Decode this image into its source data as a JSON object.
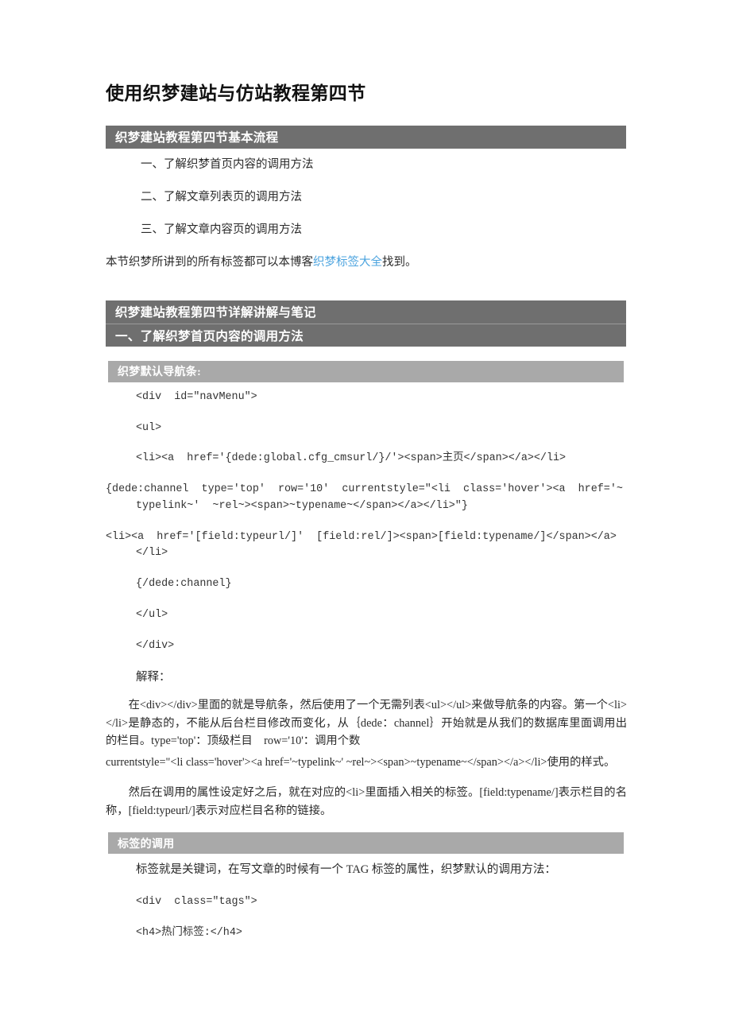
{
  "document": {
    "title": "使用织梦建站与仿站教程第四节"
  },
  "sections": {
    "overview": {
      "bar_label": "织梦建站教程第四节基本流程",
      "items": [
        "一、了解织梦首页内容的调用方法",
        "二、了解文章列表页的调用方法",
        "三、了解文章内容页的调用方法"
      ],
      "note_before_link": "本节织梦所讲到的所有标签都可以本博客",
      "note_link_text": "织梦标签大全",
      "note_after_link": "找到。"
    },
    "detail": {
      "bar_label": "织梦建站教程第四节详解讲解与笔记",
      "sub_bar_label": "一、了解织梦首页内容的调用方法"
    },
    "navbar": {
      "bar_label": "织梦默认导航条:",
      "code_lines": [
        "<div  id=\"navMenu\">",
        "<ul>",
        "<li><a  href='{dede:global.cfg_cmsurl/}/'><span>主页</span></a></li>",
        "{dede:channel  type='top'  row='10'  currentstyle=\"<li  class='hover'><a  href='~typelink~'  ~rel~><span>~typename~</span></a></li>\"}",
        "<li><a  href='[field:typeurl/]'  [field:rel/]><span>[field:typename/]</span></a></li>",
        "{/dede:channel}",
        "</ul>",
        "</div>"
      ],
      "explain_label": "解释：",
      "explain_p1": "在<div></div>里面的就是导航条，然后使用了一个无需列表<ul></ul>来做导航条的内容。第一个<li></li>是静态的，不能从后台栏目修改而变化，从｛dede：channel｝开始就是从我们的数据库里面调用出的栏目。type='top'：顶级栏目　row='10'：调用个数",
      "explain_p2": "currentstyle=\"<li class='hover'><a href='~typelink~' ~rel~><span>~typename~</span></a></li>使用的样式。",
      "explain_p3": "然后在调用的属性设定好之后，就在对应的<li>里面插入相关的标签。[field:typename/]表示栏目的名称，[field:typeurl/]表示对应栏目名称的链接。"
    },
    "tags": {
      "bar_label": "标签的调用",
      "intro": "标签就是关键词，在写文章的时候有一个 TAG 标签的属性，织梦默认的调用方法：",
      "code_lines": [
        "<div  class=\"tags\">",
        "<h4>热门标签:</h4>"
      ]
    }
  },
  "colors": {
    "bar_dark": "#6f6f6f",
    "bar_light": "#a9a9a9",
    "link": "#4da4df",
    "page_background": "#ffffff",
    "body_text": "#2a2a2a"
  }
}
